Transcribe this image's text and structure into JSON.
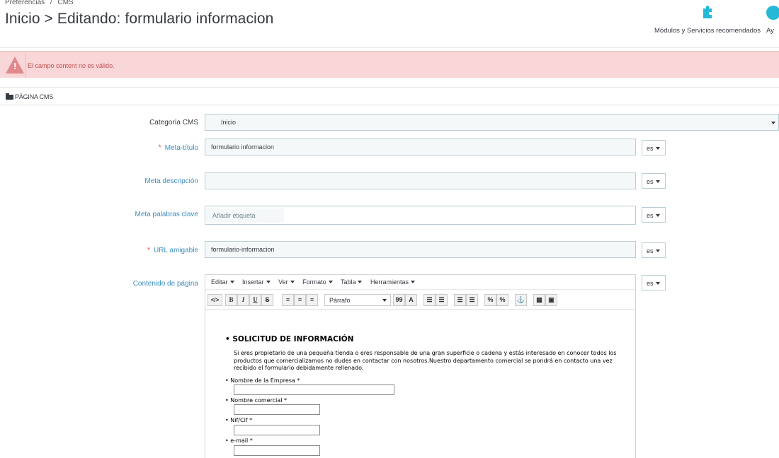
{
  "breadcrumb": [
    "Preferencias",
    "/",
    "CMS"
  ],
  "page_title": "Inicio > Editando: formulario informacion",
  "toolbar": {
    "modules_label": "Módulos y Servicios recomendados",
    "help_label": "Ay"
  },
  "alert": {
    "message": "El campo content no es válido."
  },
  "panel": {
    "title": "PÁGINA CMS"
  },
  "form": {
    "categoria": {
      "label": "Categoría CMS",
      "value": "Inicio"
    },
    "meta_titulo": {
      "required": "*",
      "label": "Meta-título",
      "value": "formulario informacion",
      "lang": "es"
    },
    "meta_descripcion": {
      "label": "Meta descripción",
      "value": "",
      "lang": "es"
    },
    "meta_palabras": {
      "label": "Meta palabras clave",
      "placeholder": "Añadir etiqueta",
      "lang": "es"
    },
    "url_amigable": {
      "required": "*",
      "label": "URL amigable",
      "value": "formulario-informacion",
      "lang": "es"
    },
    "contenido": {
      "label": "Contenido de página",
      "lang": "es"
    }
  },
  "editor": {
    "menus": [
      "Editar",
      "Insertar",
      "Ver",
      "Formato",
      "Tabla",
      "Herramientas"
    ],
    "toolbar_buttons": {
      "code": "</>",
      "bold": "B",
      "italic": "I",
      "underline": "U",
      "strike": "S",
      "align_left": "≡",
      "align_center": "≡",
      "align_right": "≡",
      "format_select": "Párrafo",
      "quote": "99",
      "text_color": "A",
      "bullet_list": "☰",
      "numbered_list": "☰",
      "outdent": "☰",
      "indent": "☰",
      "link": "%",
      "unlink": "%",
      "anchor": "⚓",
      "media": "▦",
      "image": "▣"
    },
    "content": {
      "heading": "SOLICITUD DE INFORMACIÓN",
      "paragraph": "Si eres propietario de una pequeña tienda o eres responsable de una gran superficie o cadena y estás interesado en conocer todos los productos que comercializamos no dudes en contactar con nosotros.Nuestro departamento comercial se pondrá en contacto una vez recibido el formulario debidamente rellenado.",
      "fields": [
        "Nombre de la Empresa *",
        "Nombre comercial *",
        "Nif/Cif *",
        "e-mail *"
      ]
    }
  }
}
